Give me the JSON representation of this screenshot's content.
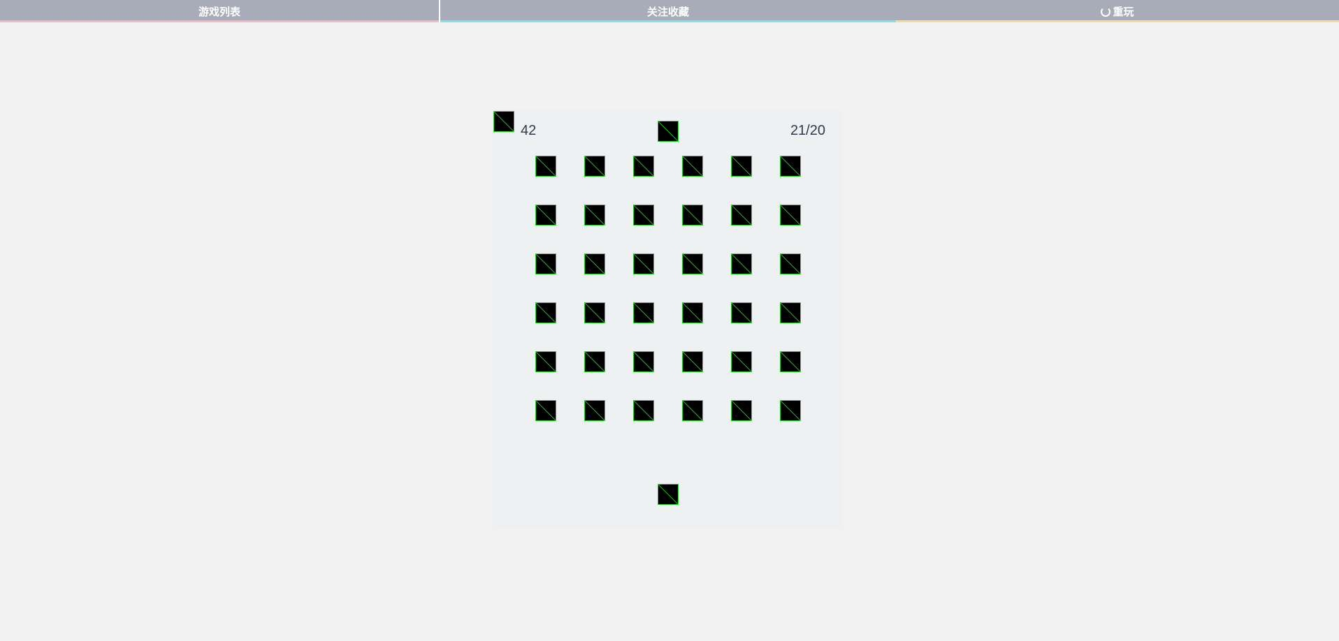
{
  "nav": {
    "tabs": [
      {
        "label": "游戏列表",
        "accent": "#f0b8c0"
      },
      {
        "label": "关注收藏",
        "accent": "#7fe3e0"
      },
      {
        "label": "重玩",
        "icon": "refresh-icon",
        "accent": "#f5dc9a"
      }
    ]
  },
  "game": {
    "score": "42",
    "progress": "21/20",
    "grid": {
      "rows": 6,
      "cols": 6
    },
    "tile_icon": "broken-image-icon",
    "colors": {
      "tile_fill": "#000000",
      "tile_border": "#1ed81e",
      "board_bg": "#edf1f2"
    }
  }
}
